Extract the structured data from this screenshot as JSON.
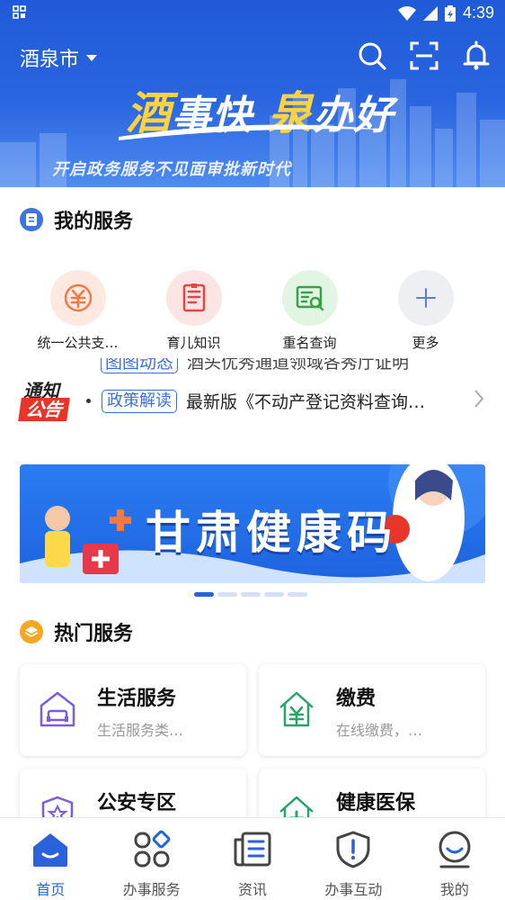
{
  "status_bar": {
    "time": "4:39"
  },
  "header": {
    "city": "酒泉市",
    "slogan_parts": [
      "酒",
      "事快",
      "泉",
      "办好"
    ],
    "tagline": "开启政务服务不见面审批新时代"
  },
  "my_services": {
    "title": "我的服务",
    "items": [
      {
        "label": "统一公共支…",
        "icon": "yuan-coin-icon"
      },
      {
        "label": "育儿知识",
        "icon": "book-icon"
      },
      {
        "label": "重名查询",
        "icon": "id-card-search-icon"
      },
      {
        "label": "更多",
        "icon": "plus-icon"
      }
    ]
  },
  "notice": {
    "logo_top": "通知",
    "logo_bottom": "公告",
    "prev_tag": "图图动态",
    "prev_text": "酒头优秀通道领域各秀厅证明",
    "tag": "政策解读",
    "text": "最新版《不动产登记资料查询…"
  },
  "banner": {
    "title": "甘肃健康码"
  },
  "hot_services": {
    "title": "热门服务",
    "items": [
      {
        "title": "生活服务",
        "subtitle": "生活服务类…",
        "icon": "home-sofa-icon"
      },
      {
        "title": "缴费",
        "subtitle": "在线缴费，…",
        "icon": "house-yuan-icon"
      },
      {
        "title": "公安专区",
        "subtitle": "",
        "icon": "police-shield-icon"
      },
      {
        "title": "健康医保",
        "subtitle": "",
        "icon": "medical-cross-icon"
      }
    ]
  },
  "tabbar": {
    "items": [
      {
        "label": "首页",
        "icon": "home-icon",
        "active": true
      },
      {
        "label": "办事服务",
        "icon": "apps-icon",
        "active": false
      },
      {
        "label": "资讯",
        "icon": "news-icon",
        "active": false
      },
      {
        "label": "办事互动",
        "icon": "shield-alert-icon",
        "active": false
      },
      {
        "label": "我的",
        "icon": "profile-icon",
        "active": false
      }
    ]
  },
  "colors": {
    "primary": "#2a62dc",
    "header": "#1f5ad8",
    "alert_red": "#e8352a"
  }
}
